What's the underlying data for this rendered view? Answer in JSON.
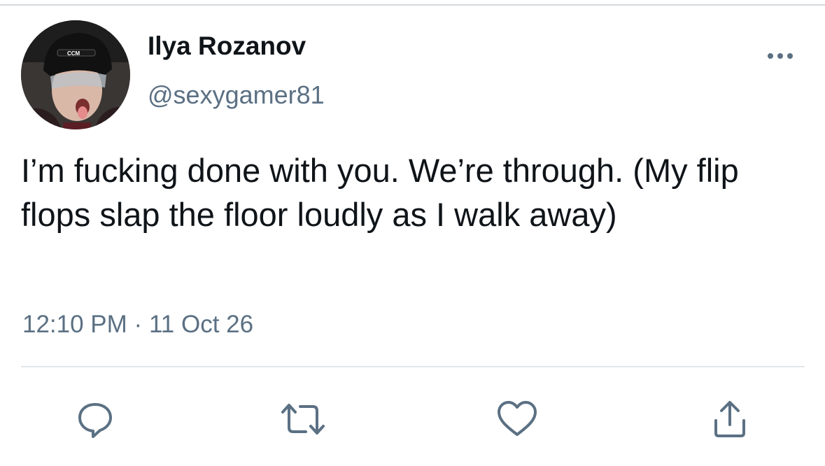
{
  "tweet": {
    "display_name": "Ilya Rozanov",
    "handle": "@sexygamer81",
    "text": "I’m fucking done with you. We’re through. (My flip flops slap the floor loudly as I walk away)",
    "time": "12:10 PM",
    "separator": "·",
    "date": "11 Oct 26",
    "avatar_helmet_logo": "CCM"
  },
  "icons": {
    "more": "more-horizontal-icon",
    "reply": "reply-icon",
    "retweet": "retweet-icon",
    "like": "heart-icon",
    "share": "share-icon"
  },
  "colors": {
    "text_primary": "#0f1419",
    "text_secondary": "#5b7083",
    "icon": "#5b7083",
    "divider": "#e3e6e8"
  }
}
